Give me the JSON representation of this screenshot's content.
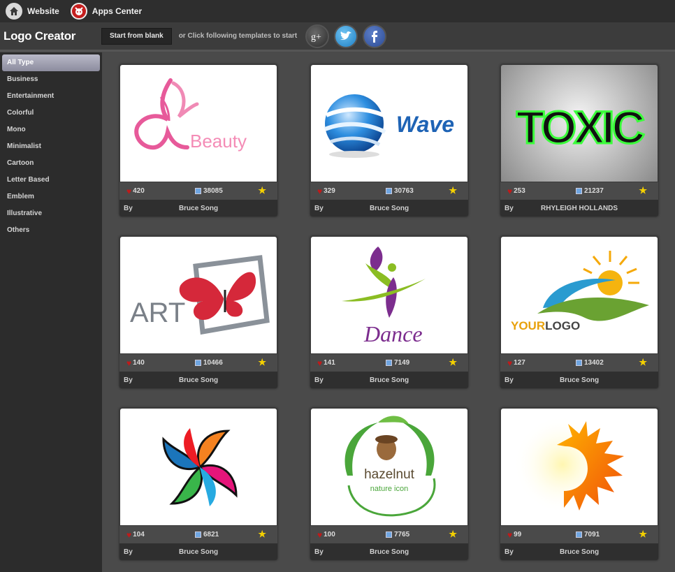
{
  "topbar": {
    "website_label": "Website",
    "apps_label": "Apps Center"
  },
  "header": {
    "title": "Logo Creator",
    "start_label": "Start from blank",
    "hint": "or Click following templates to start"
  },
  "sidebar": {
    "items": [
      {
        "label": "All Type",
        "active": true
      },
      {
        "label": "Business"
      },
      {
        "label": "Entertainment"
      },
      {
        "label": "Colorful"
      },
      {
        "label": "Mono"
      },
      {
        "label": "Minimalist"
      },
      {
        "label": "Cartoon"
      },
      {
        "label": "Letter Based"
      },
      {
        "label": "Emblem"
      },
      {
        "label": "Illustrative"
      },
      {
        "label": "Others"
      }
    ]
  },
  "templates": [
    {
      "likes": "420",
      "edits": "38085",
      "by": "By",
      "author": "Bruce Song",
      "logo_text": "Beauty"
    },
    {
      "likes": "329",
      "edits": "30763",
      "by": "By",
      "author": "Bruce Song",
      "logo_text": "Wave"
    },
    {
      "likes": "253",
      "edits": "21237",
      "by": "By",
      "author": "RHYLEIGH HOLLANDS",
      "logo_text": "TOXIC"
    },
    {
      "likes": "140",
      "edits": "10466",
      "by": "By",
      "author": "Bruce Song",
      "logo_text": "ART"
    },
    {
      "likes": "141",
      "edits": "7149",
      "by": "By",
      "author": "Bruce Song",
      "logo_text": "Dance"
    },
    {
      "likes": "127",
      "edits": "13402",
      "by": "By",
      "author": "Bruce Song",
      "logo_text_a": "YOUR",
      "logo_text_b": "LOGO"
    },
    {
      "likes": "104",
      "edits": "6821",
      "by": "By",
      "author": "Bruce Song"
    },
    {
      "likes": "100",
      "edits": "7765",
      "by": "By",
      "author": "Bruce Song",
      "logo_text": "hazelnut",
      "logo_sub": "nature icon"
    },
    {
      "likes": "99",
      "edits": "7091",
      "by": "By",
      "author": "Bruce Song"
    }
  ],
  "icons": {
    "home": "home-icon",
    "apps": "apps-center-icon",
    "google_plus": "google-plus-icon",
    "twitter": "twitter-icon",
    "facebook": "facebook-icon",
    "like": "heart-icon",
    "edit": "edit-icon",
    "favorite": "star-icon"
  },
  "colors": {
    "accent_heart": "#c01a1a",
    "star": "#f4d000",
    "active_category": "#a5a5b8"
  }
}
